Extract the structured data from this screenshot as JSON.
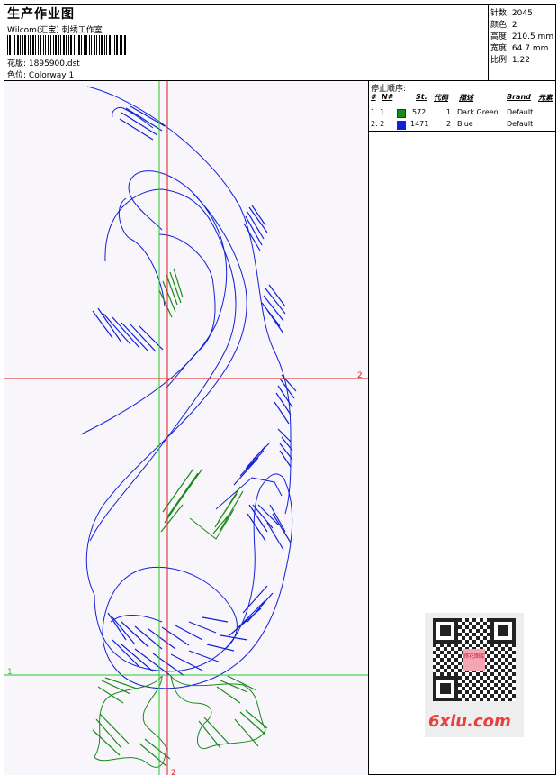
{
  "header": {
    "title": "生产作业图",
    "company": "Wilcom(汇宝) 刺绣工作室",
    "design_label": "花版:",
    "design_file": "1895900.dst",
    "colorway_label": "色位:",
    "colorway": "Colorway 1"
  },
  "stats": {
    "stitches_label": "针数:",
    "stitches": "2045",
    "colors_label": "颜色:",
    "colors": "2",
    "height_label": "高度:",
    "height": "210.5 mm",
    "width_label": "宽度:",
    "width": "64.7 mm",
    "scale_label": "比例:",
    "scale": "1.22"
  },
  "stop_sequence": {
    "title": "停止顺序:",
    "columns": [
      "#",
      "N#",
      "St.",
      "代码",
      "描述",
      "Brand",
      "元素"
    ],
    "rows": [
      {
        "idx": "1. 1",
        "color": "#1a8a1a",
        "stitches": "572",
        "code": "1",
        "desc": "Dark Green",
        "brand": "Default"
      },
      {
        "idx": "2. 2",
        "color": "#1020d8",
        "stitches": "1471",
        "code": "2",
        "desc": "Blue",
        "brand": "Default"
      }
    ]
  },
  "guides": {
    "mark_h": "2",
    "mark_v": "2",
    "mark_green": "1"
  },
  "watermark": {
    "text": "6xiu.com",
    "stamp": "绣花图库"
  },
  "colors": {
    "guide_red": "#e01818",
    "guide_green": "#22cc22",
    "thread_blue": "#1020d8",
    "thread_green": "#1a8a1a"
  }
}
